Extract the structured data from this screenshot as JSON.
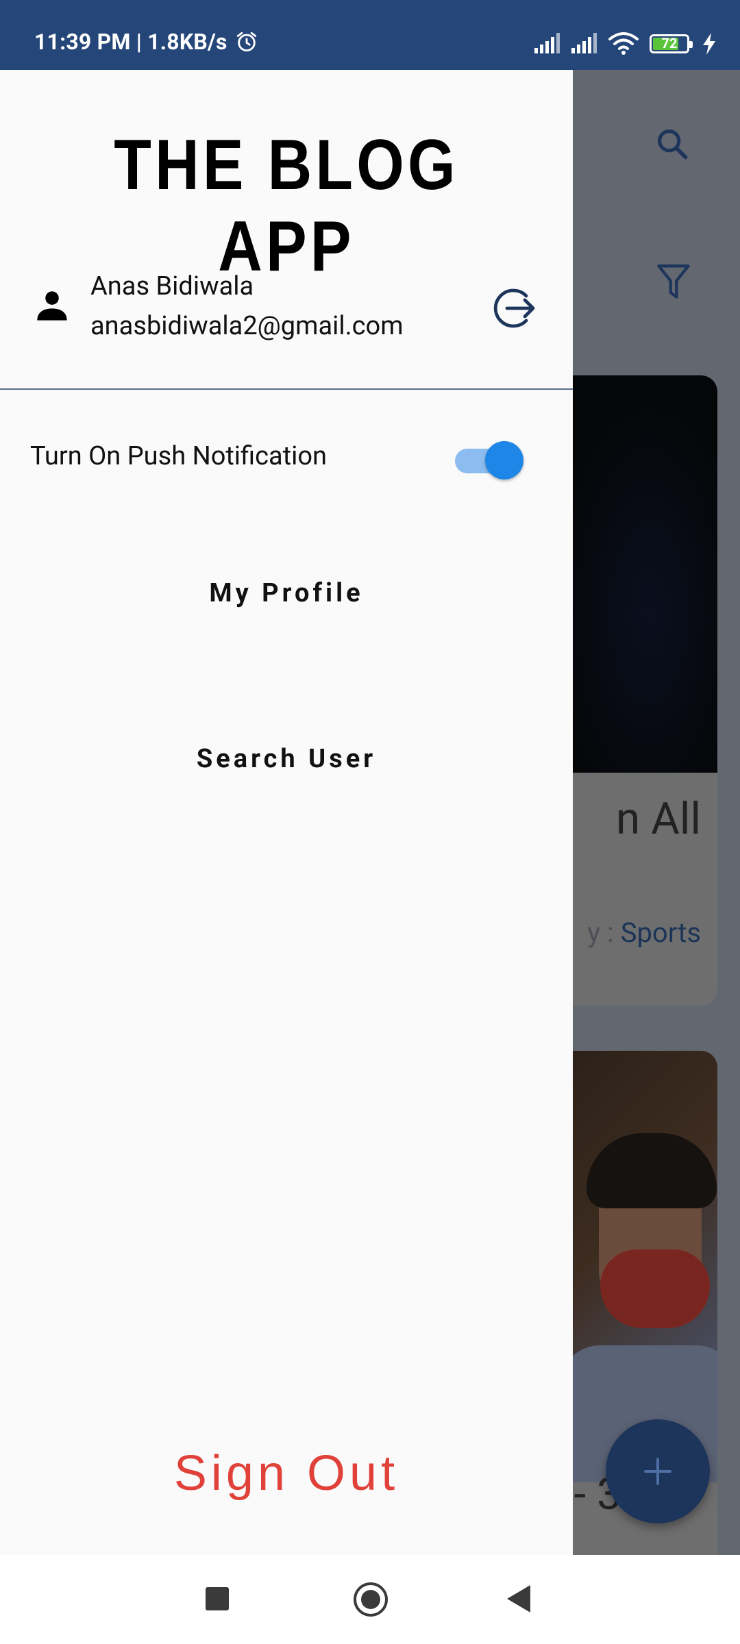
{
  "status_bar": {
    "time": "11:39 PM | 1.8KB/s",
    "battery": "72",
    "icons": [
      "alarm-icon",
      "signal-icon",
      "signal-icon",
      "wifi-icon",
      "battery-icon",
      "charging-bolt-icon"
    ]
  },
  "drawer": {
    "title": "THE BLOG APP",
    "user": {
      "name": "Anas Bidiwala",
      "email": "anasbidiwala2@gmail.com",
      "icon": "person-icon",
      "logout_icon": "logout-icon"
    },
    "push_notification": {
      "label": "Turn On Push Notification",
      "enabled": true
    },
    "menu_items": [
      {
        "label": "My Profile"
      },
      {
        "label": "Search User"
      }
    ],
    "sign_out_label": "Sign Out"
  },
  "background": {
    "card1_title": "n All",
    "card1_category_prefix": "y : ",
    "card1_category": "Sports",
    "card2_title": "- 3"
  },
  "colors": {
    "status_bar": "#254679",
    "accent": "#1e86e6",
    "sign_out": "#e0423a",
    "fab": "#1e355b"
  }
}
